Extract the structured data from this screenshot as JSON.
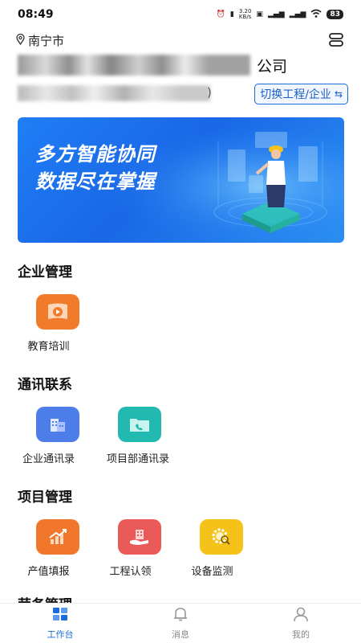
{
  "status_bar": {
    "time": "08:49",
    "net_speed_value": "3.20",
    "net_speed_unit": "KB/s",
    "battery": "83"
  },
  "header": {
    "location": "南宁市",
    "company_suffix": "公司",
    "project_paren": ")",
    "switch_label": "切换工程/企业"
  },
  "banner": {
    "line1": "多方智能协同",
    "line2": "数据尽在掌握"
  },
  "sections": [
    {
      "title": "企业管理",
      "items": [
        {
          "label": "教育培训",
          "icon": "video-training-icon",
          "color": "#f07b2b"
        }
      ]
    },
    {
      "title": "通讯联系",
      "items": [
        {
          "label": "企业通讯录",
          "icon": "building-contacts-icon",
          "color": "#4c7de9"
        },
        {
          "label": "项目部通讯录",
          "icon": "folder-phone-icon",
          "color": "#22b9b0"
        }
      ]
    },
    {
      "title": "项目管理",
      "items": [
        {
          "label": "产值填报",
          "icon": "chart-growth-icon",
          "color": "#f1782b"
        },
        {
          "label": "工程认领",
          "icon": "hand-building-icon",
          "color": "#ea5a58"
        },
        {
          "label": "设备监测",
          "icon": "gear-monitor-icon",
          "color": "#f5c21a"
        }
      ]
    },
    {
      "title": "劳务管理"
    }
  ],
  "tabbar": {
    "tabs": [
      {
        "label": "工作台",
        "icon": "workbench-icon"
      },
      {
        "label": "消息",
        "icon": "bell-icon"
      },
      {
        "label": "我的",
        "icon": "profile-icon"
      }
    ]
  },
  "colors": {
    "accent": "#1b6bd9",
    "banner": "#1f7ef5"
  }
}
